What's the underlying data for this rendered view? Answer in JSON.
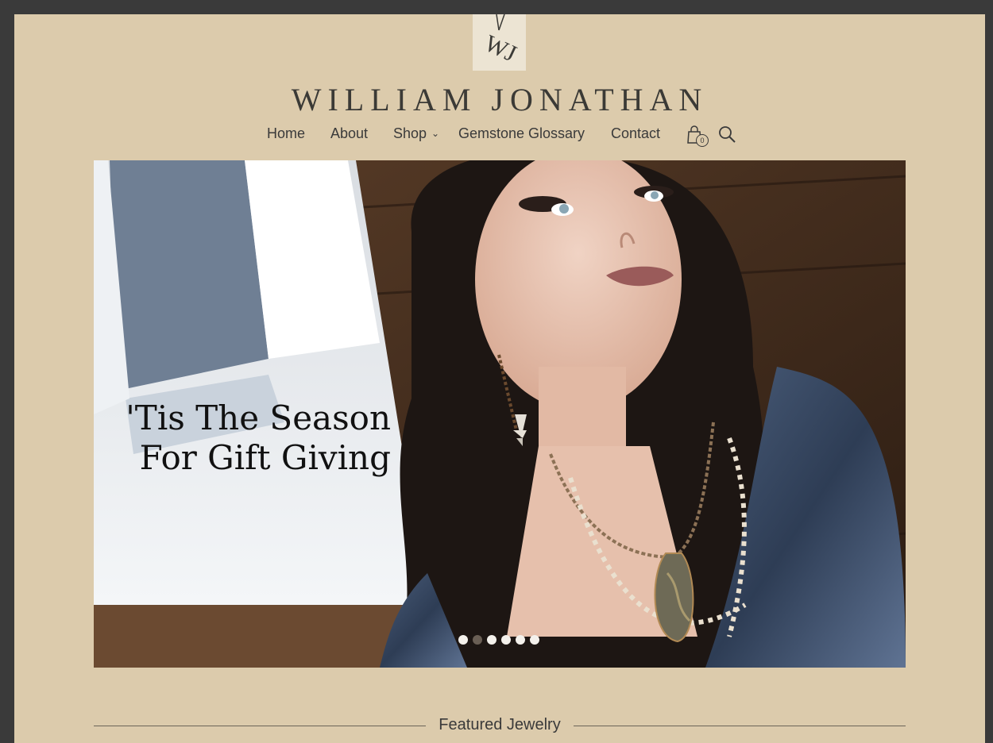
{
  "brand": {
    "name": "WILLIAM JONATHAN",
    "logo_letters": "WJ"
  },
  "nav": {
    "items": [
      {
        "label": "Home"
      },
      {
        "label": "About"
      },
      {
        "label": "Shop",
        "has_dropdown": true
      },
      {
        "label": "Gemstone Glossary"
      },
      {
        "label": "Contact"
      }
    ],
    "cart_count": "0",
    "cart_icon": "shopping-bag-icon",
    "search_icon": "search-icon"
  },
  "hero": {
    "headline_line1": "'Tis The Season",
    "headline_line2": "For Gift Giving",
    "slide_count": 6,
    "active_slide": 2
  },
  "featured": {
    "title": "Featured Jewelry"
  },
  "colors": {
    "page_bg": "#dccbac",
    "frame_bg": "#3a3a3a",
    "text": "#3a3a3a"
  }
}
